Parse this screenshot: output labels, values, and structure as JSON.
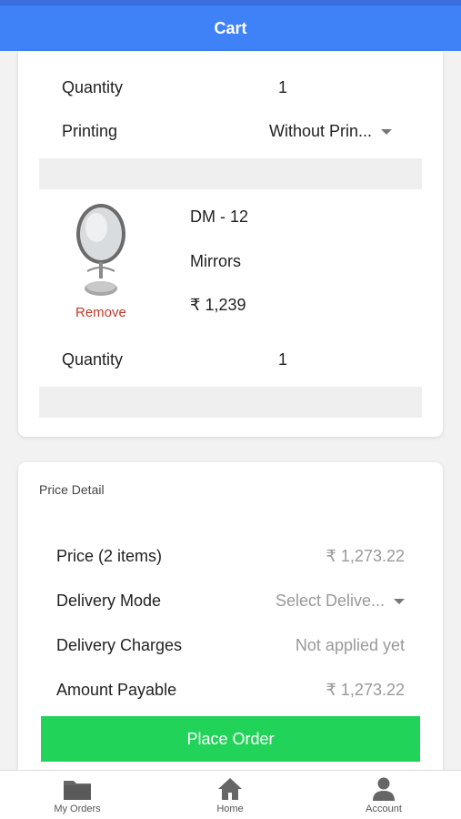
{
  "appbar": {
    "title": "Cart"
  },
  "cart": {
    "item1": {
      "quantity_label": "Quantity",
      "quantity_value": "1",
      "printing_label": "Printing",
      "printing_value": "Without Prin..."
    },
    "item2": {
      "name": "DM - 12",
      "category": "Mirrors",
      "price": "₹ 1,239",
      "remove_label": "Remove",
      "quantity_label": "Quantity",
      "quantity_value": "1",
      "image_icon": "mirror-image"
    }
  },
  "price_detail": {
    "title": "Price Detail",
    "price_label": "Price (2 items)",
    "price_value": "₹ 1,273.22",
    "delivery_mode_label": "Delivery Mode",
    "delivery_mode_placeholder": "Select Delive...",
    "delivery_charges_label": "Delivery Charges",
    "delivery_charges_value": "Not applied yet",
    "amount_payable_label": "Amount Payable",
    "amount_payable_value": "₹ 1,273.22",
    "place_order_label": "Place Order"
  },
  "bottom_nav": {
    "items": [
      {
        "label": "My Orders",
        "icon": "folder-icon"
      },
      {
        "label": "Home",
        "icon": "home-icon"
      },
      {
        "label": "Account",
        "icon": "user-icon"
      }
    ]
  },
  "colors": {
    "appbar": "#3f81f6",
    "place_order": "#22d35a",
    "remove": "#c0392b"
  }
}
